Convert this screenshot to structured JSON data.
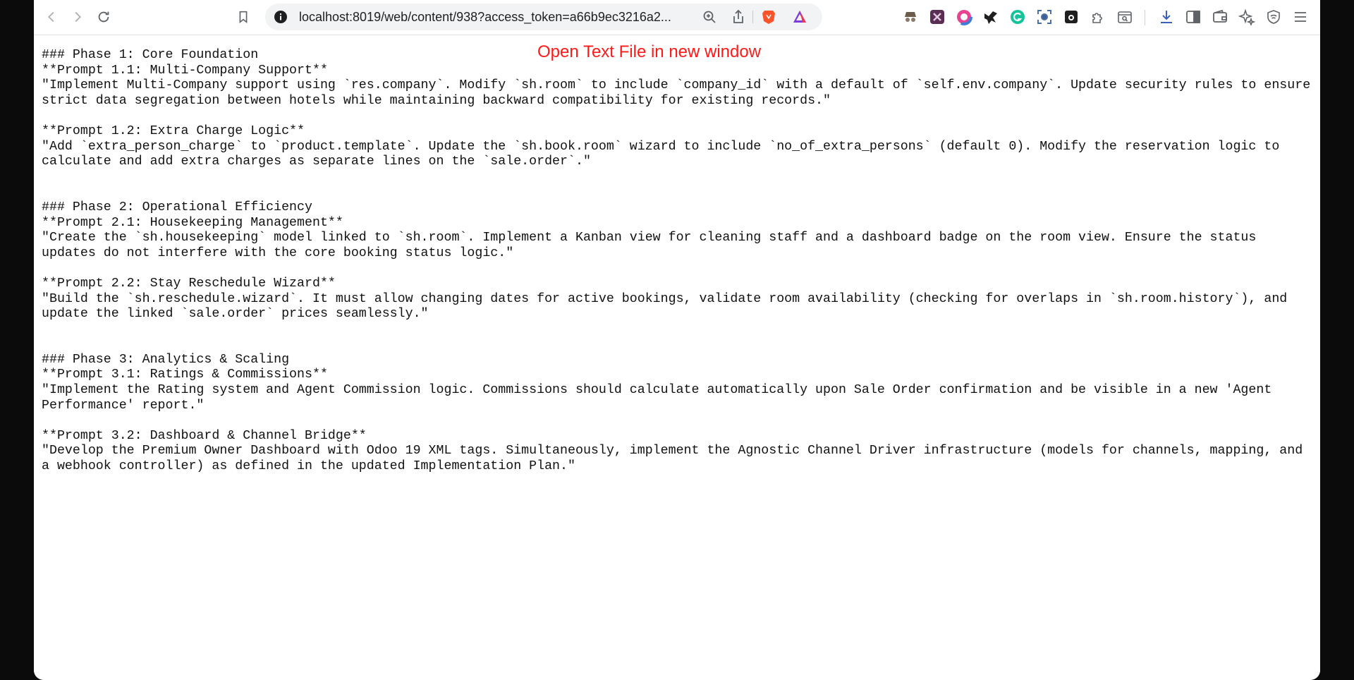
{
  "browser": {
    "address_url": "localhost:8019/web/content/938?access_token=a66b9ec3216a2..."
  },
  "page": {
    "open_link_label": "Open Text File in new window",
    "lines": [
      "### Phase 1: Core Foundation",
      "**Prompt 1.1: Multi-Company Support**",
      "\"Implement Multi-Company support using `res.company`. Modify `sh.room` to include `company_id` with a default of `self.env.company`. Update security rules to ensure strict data segregation between hotels while maintaining backward compatibility for existing records.\"",
      "",
      "**Prompt 1.2: Extra Charge Logic**",
      "\"Add `extra_person_charge` to `product.template`. Update the `sh.book.room` wizard to include `no_of_extra_persons` (default 0). Modify the reservation logic to calculate and add extra charges as separate lines on the `sale.order`.\"",
      "",
      "",
      "### Phase 2: Operational Efficiency",
      "**Prompt 2.1: Housekeeping Management**",
      "\"Create the `sh.housekeeping` model linked to `sh.room`. Implement a Kanban view for cleaning staff and a dashboard badge on the room view. Ensure the status updates do not interfere with the core booking status logic.\"",
      "",
      "**Prompt 2.2: Stay Reschedule Wizard**",
      "\"Build the `sh.reschedule.wizard`. It must allow changing dates for active bookings, validate room availability (checking for overlaps in `sh.room.history`), and update the linked `sale.order` prices seamlessly.\"",
      "",
      "",
      "### Phase 3: Analytics & Scaling",
      "**Prompt 3.1: Ratings & Commissions**",
      "\"Implement the Rating system and Agent Commission logic. Commissions should calculate automatically upon Sale Order confirmation and be visible in a new 'Agent Performance' report.\"",
      "",
      "**Prompt 3.2: Dashboard & Channel Bridge**",
      "\"Develop the Premium Owner Dashboard with Odoo 19 XML tags. Simultaneously, implement the Agnostic Channel Driver infrastructure (models for channels, mapping, and a webhook controller) as defined in the updated Implementation Plan.\""
    ]
  },
  "colors": {
    "link_red": "#ff1a1a",
    "brave_orange": "#fb542b",
    "text": "#111111"
  }
}
